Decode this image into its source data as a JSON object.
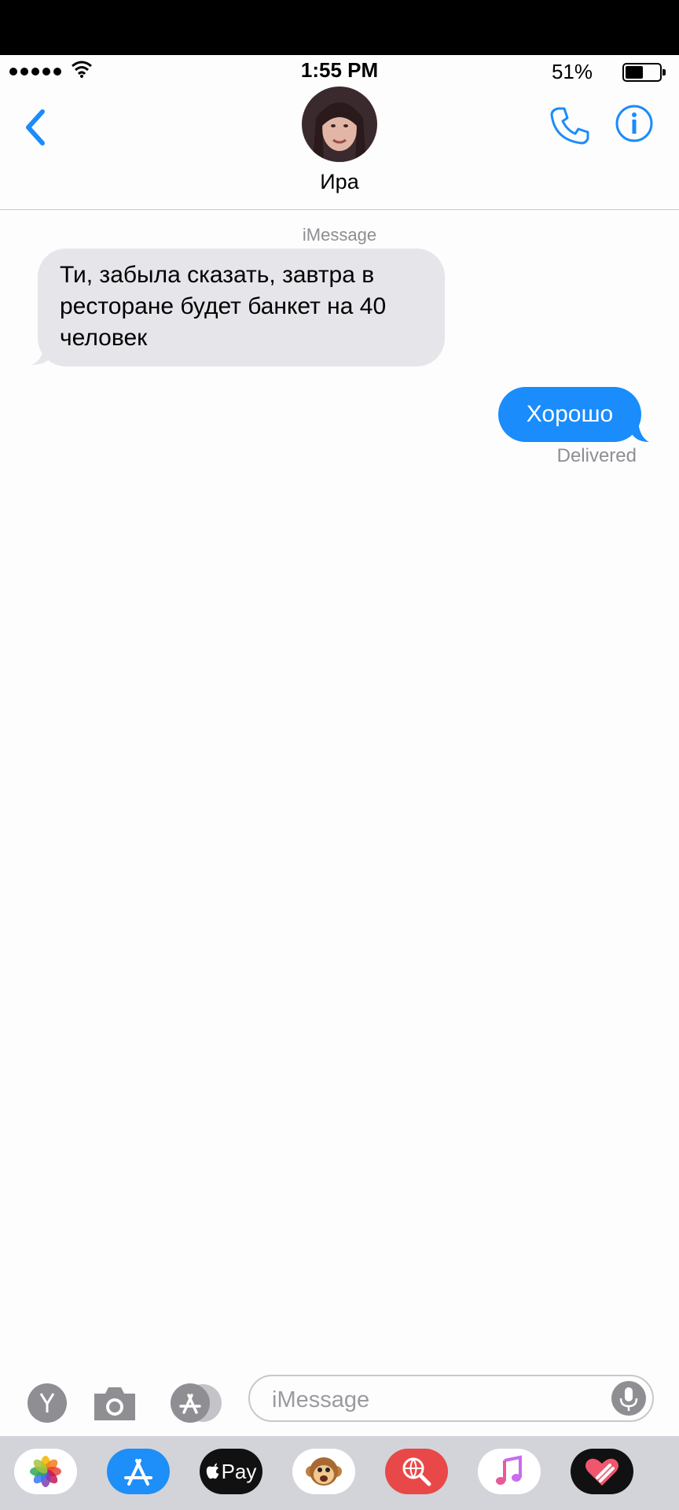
{
  "status": {
    "time": "1:55 PM",
    "battery_percent": "51%",
    "battery_level": 0.51
  },
  "header": {
    "contact_name": "Ира",
    "back_icon": "chevron-left-icon",
    "call_icon": "phone-icon",
    "info_icon": "info-icon"
  },
  "thread": {
    "service_label": "iMessage",
    "messages": [
      {
        "direction": "incoming",
        "text": "Ти, забыла сказать, завтра в ресторане будет банкет на 40 человек"
      },
      {
        "direction": "outgoing",
        "text": "Хорошо",
        "status": "Delivered"
      }
    ]
  },
  "composer": {
    "placeholder": "iMessage",
    "left_icons": [
      "y-icon",
      "camera-icon",
      "app-store-icon"
    ],
    "mic_icon": "microphone-icon"
  },
  "app_drawer": {
    "apps": [
      {
        "name": "photos-app-icon"
      },
      {
        "name": "app-store-app-icon"
      },
      {
        "name": "apple-pay-app-icon",
        "label": "Pay"
      },
      {
        "name": "animoji-app-icon"
      },
      {
        "name": "web-search-app-icon"
      },
      {
        "name": "music-app-icon"
      },
      {
        "name": "digital-touch-app-icon"
      }
    ]
  },
  "colors": {
    "accent": "#1a8cfb",
    "incoming_bubble": "#e5e5ea",
    "secondary_text": "#8e8e93",
    "drawer_bg": "#d2d4da"
  }
}
